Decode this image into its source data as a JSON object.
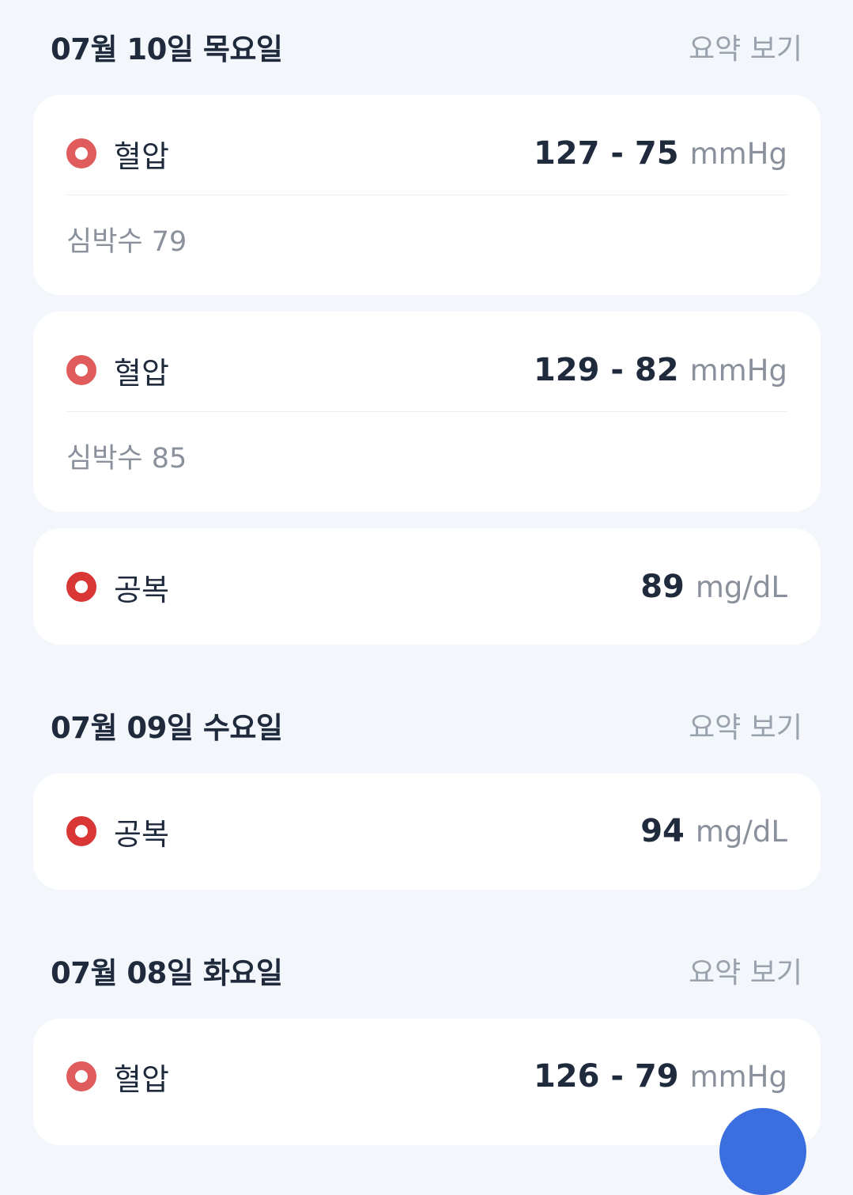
{
  "days": [
    {
      "date": "07월 10일 목요일",
      "summary_label": "요약 보기",
      "records": [
        {
          "type": "혈압",
          "value": "127 - 75",
          "unit": "mmHg",
          "sub": "심박수 79"
        },
        {
          "type": "혈압",
          "value": "129 - 82",
          "unit": "mmHg",
          "sub": "심박수 85"
        },
        {
          "type": "공복",
          "value": "89",
          "unit": "mg/dL"
        }
      ]
    },
    {
      "date": "07월 09일 수요일",
      "summary_label": "요약 보기",
      "records": [
        {
          "type": "공복",
          "value": "94",
          "unit": "mg/dL"
        }
      ]
    },
    {
      "date": "07월 08일 화요일",
      "summary_label": "요약 보기",
      "records": [
        {
          "type": "혈압",
          "value": "126 - 79",
          "unit": "mmHg"
        }
      ]
    }
  ],
  "colors": {
    "background": "#f3f6fa",
    "blood_pressure_dot": "#e05c5c",
    "glucose_dot": "#d93636",
    "primary_text": "#1f2a3d",
    "secondary_text": "#8a919c",
    "fab": "#3b6fe0"
  }
}
